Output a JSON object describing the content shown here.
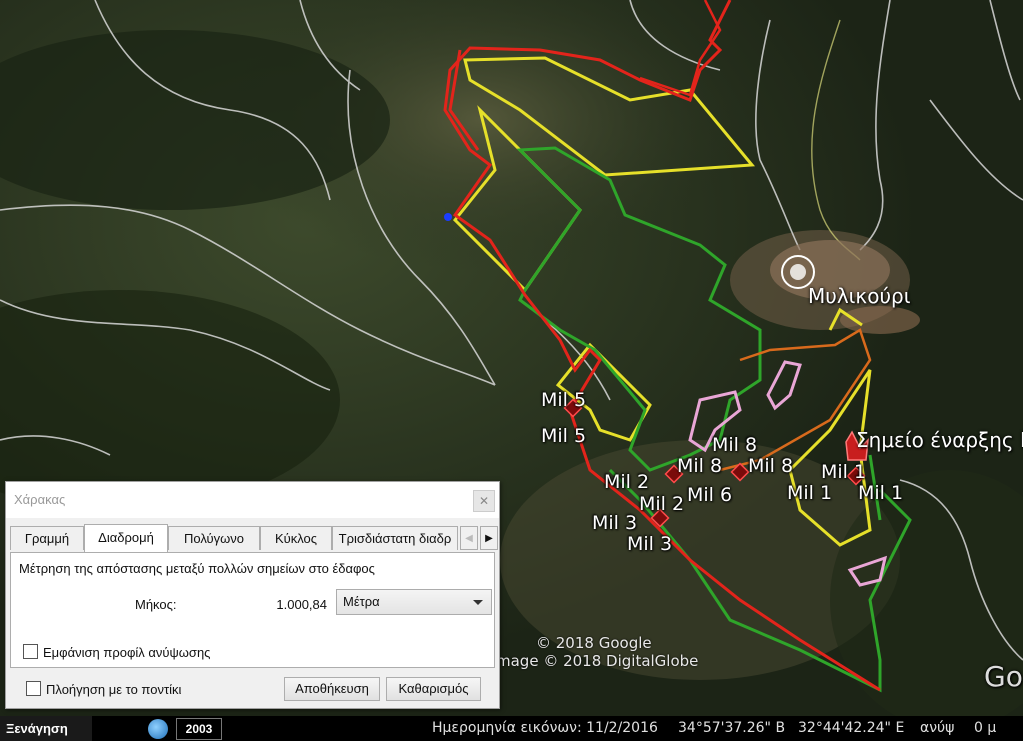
{
  "map": {
    "place_name": "Μυλικούρι",
    "start_point": "Σημείο έναρξης Π",
    "markers": [
      {
        "label": "Mil 5"
      },
      {
        "label": "Mil 5"
      },
      {
        "label": "Mil 8"
      },
      {
        "label": "Mil 8"
      },
      {
        "label": "Mil 8"
      },
      {
        "label": "Mil 6"
      },
      {
        "label": "Mil 2"
      },
      {
        "label": "Mil 2"
      },
      {
        "label": "Mil 3"
      },
      {
        "label": "Mil 3"
      },
      {
        "label": "Mil 1"
      },
      {
        "label": "Mil 1"
      },
      {
        "label": "Mil 1"
      }
    ],
    "credit_google": "© 2018 Google",
    "credit_image": "mage © 2018 DigitalGlobe",
    "logo_partial": "Go",
    "colors": {
      "route": "#e3241b",
      "yellow_area": "#e6e02a",
      "green_area": "#2fa52a",
      "pink_area": "#e9a6d6",
      "orange_area": "#d86a1c"
    }
  },
  "ruler": {
    "title": "Χάρακας",
    "close_icon": "close-icon",
    "tabs": [
      {
        "label": "Γραμμή",
        "active": false
      },
      {
        "label": "Διαδρομή",
        "active": true
      },
      {
        "label": "Πολύγωνο",
        "active": false
      },
      {
        "label": "Κύκλος",
        "active": false
      },
      {
        "label": "Τρισδιάστατη διαδρ",
        "active": false
      }
    ],
    "description": "Μέτρηση της απόστασης μεταξύ πολλών σημείων στο έδαφος",
    "length_label": "Μήκος:",
    "length_value": "1.000,84",
    "unit": "Μέτρα",
    "show_elevation_label": "Εμφάνιση προφίλ ανύψωσης",
    "mouse_nav_label": "Πλοήγηση με το ποντίκι",
    "save_label": "Αποθήκευση",
    "clear_label": "Καθαρισμός"
  },
  "status": {
    "tour": "Ξενάγηση",
    "year": "2003",
    "imagery_date": "Ημερομηνία εικόνων: 11/2/2016",
    "lat": "34°57'37.26\" Β",
    "lon": "32°44'42.24\" Ε",
    "elev_label": "ανύψ",
    "elev_value": "0 μ"
  }
}
